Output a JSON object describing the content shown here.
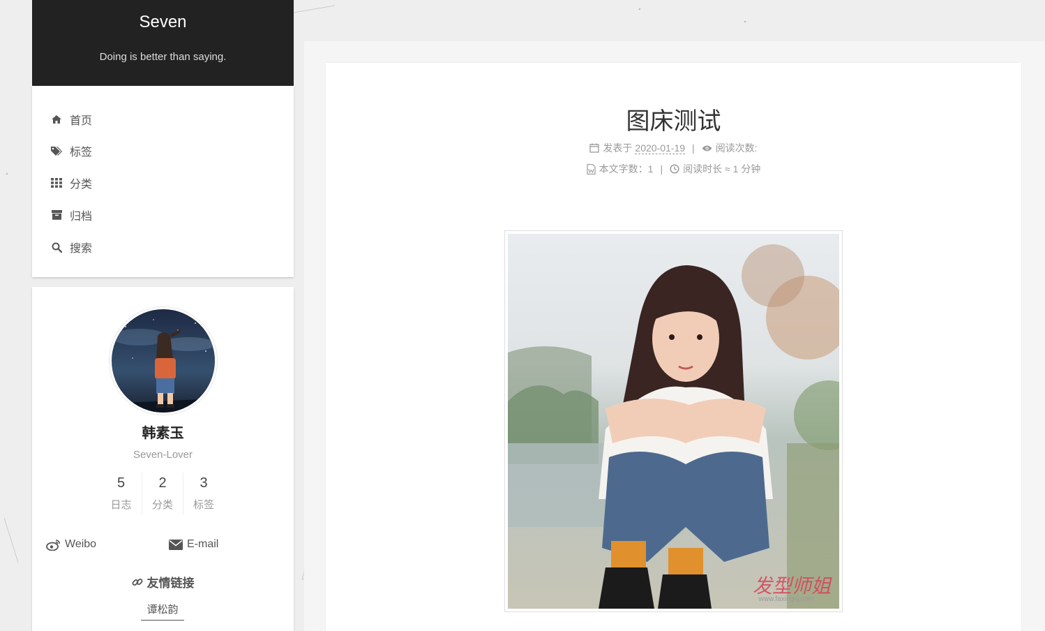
{
  "site": {
    "title": "Seven",
    "subtitle": "Doing is better than saying."
  },
  "menu": {
    "items": [
      {
        "label": "首页",
        "icon": "home-icon"
      },
      {
        "label": "标签",
        "icon": "tags-icon"
      },
      {
        "label": "分类",
        "icon": "th-icon"
      },
      {
        "label": "归档",
        "icon": "archive-icon"
      },
      {
        "label": "搜索",
        "icon": "search-icon"
      }
    ]
  },
  "author": {
    "name": "韩素玉",
    "description": "Seven-Lover",
    "stats": [
      {
        "count": "5",
        "label": "日志"
      },
      {
        "count": "2",
        "label": "分类"
      },
      {
        "count": "3",
        "label": "标签"
      }
    ],
    "social": [
      {
        "label": "Weibo",
        "icon": "weibo-icon"
      },
      {
        "label": "E-mail",
        "icon": "envelope-icon"
      }
    ],
    "links_title": "友情链接",
    "links": [
      {
        "label": "谭松韵"
      }
    ]
  },
  "post": {
    "title": "图床测试",
    "posted_label": "发表于",
    "date": "2020-01-19",
    "views_label": "阅读次数:",
    "wordcount_label": "本文字数：",
    "wordcount": "1",
    "readtime_label": "阅读时长 ≈",
    "readtime": "1 分钟",
    "separator": "|",
    "image_watermark": "发型师姐",
    "image_watermark_url": "www.faxingsj.com"
  },
  "colors": {
    "header_bg": "#222222",
    "page_bg": "#eeeeee",
    "card_bg": "#ffffff",
    "text": "#555555",
    "muted": "#999999",
    "watermark": "#d8425a"
  }
}
